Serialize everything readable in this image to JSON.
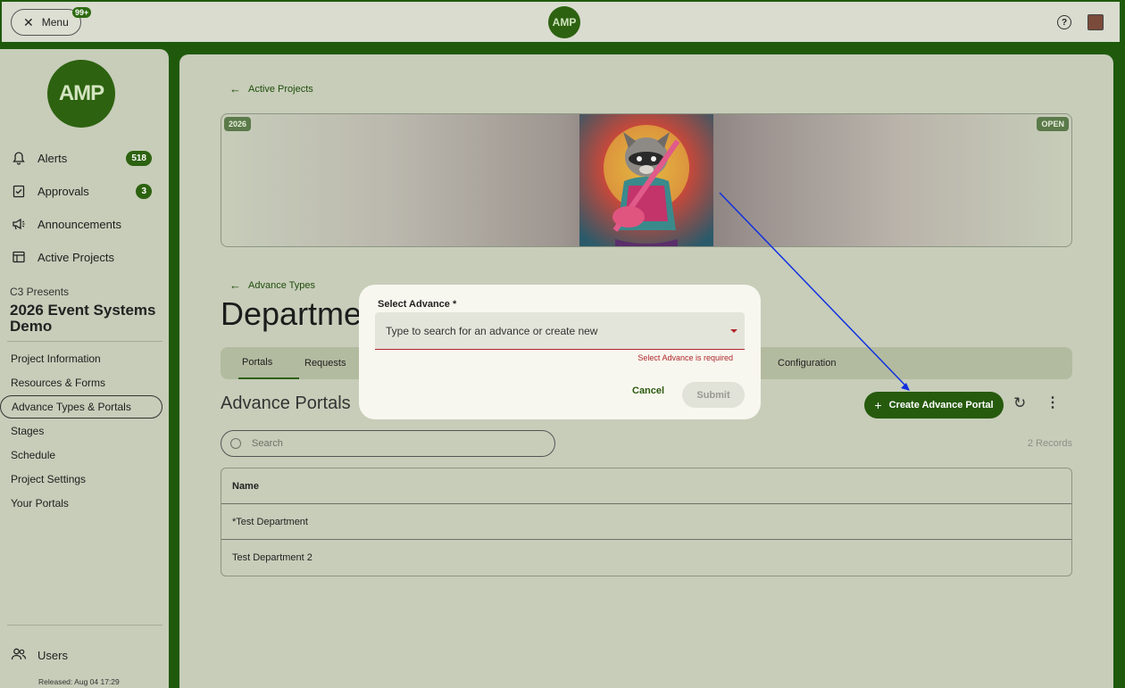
{
  "topbar": {
    "menu_label": "Menu",
    "menu_badge": "99+",
    "logo_text": "AMP",
    "help_symbol": "?"
  },
  "sidebar": {
    "logo_text": "AMP",
    "items": [
      {
        "label": "Alerts",
        "badge": "518",
        "icon": "bell-icon"
      },
      {
        "label": "Approvals",
        "badge": "3",
        "icon": "clipboard-check-icon"
      },
      {
        "label": "Announcements",
        "icon": "megaphone-icon"
      },
      {
        "label": "Active Projects",
        "icon": "project-board-icon"
      }
    ],
    "org_name": "C3 Presents",
    "project_name": "2026 Event Systems Demo",
    "project_links": [
      "Project Information",
      "Resources & Forms",
      "Advance Types & Portals",
      "Stages",
      "Schedule",
      "Project Settings",
      "Your Portals"
    ],
    "active_link": "Advance Types & Portals",
    "users_label": "Users",
    "released": "Released: Aug 04 17:29"
  },
  "main": {
    "back_active_projects": "Active Projects",
    "banner": {
      "year_chip": "2026",
      "status_chip": "OPEN"
    },
    "back_advance_types": "Advance Types",
    "page_title": "Departments",
    "tabs": [
      "Portals",
      "Requests",
      "Configuration"
    ],
    "active_tab": "Portals",
    "section_title": "Advance Portals",
    "create_button": "Create Advance Portal",
    "search_placeholder": "Search",
    "records": "2 Records",
    "table": {
      "header": "Name",
      "rows": [
        "*Test Department",
        "Test Department 2"
      ]
    }
  },
  "dialog": {
    "label": "Select Advance *",
    "placeholder": "Type to search for an advance or create new",
    "error": "Select Advance is required",
    "cancel": "Cancel",
    "submit": "Submit"
  },
  "colors": {
    "brand_green": "#2d6210",
    "frame_green": "#1f5a0c",
    "error_red": "#b0262b",
    "annotation_blue": "#1030e0"
  }
}
